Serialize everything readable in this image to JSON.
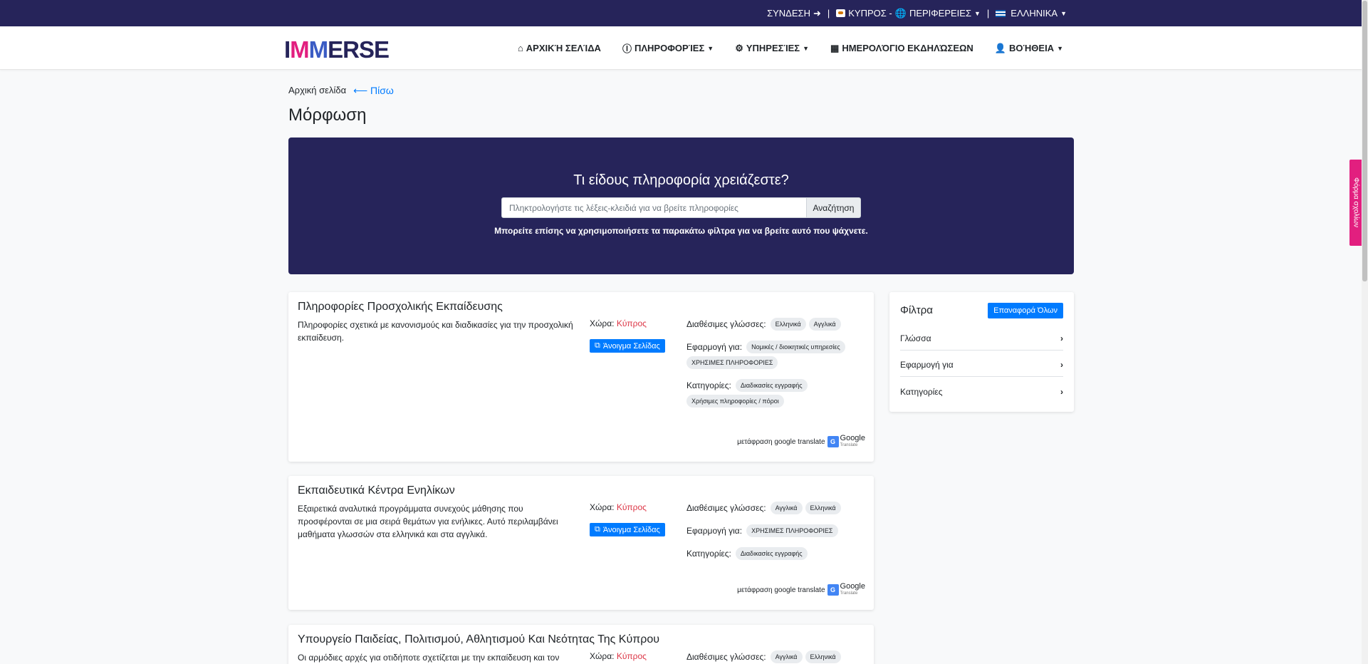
{
  "topbar": {
    "login": "ΣΥΝΔΕΣΗ",
    "country": "ΚΥΠΡΟΣ -",
    "regions": "ΠΕΡΙΦΕΡΕΙΕΣ",
    "language": "ΕΛΛΗΝΙΚΑ",
    "separator": "|"
  },
  "nav": {
    "logo": {
      "part1": "I",
      "part2": "M",
      "part3": "M",
      "part4": "ERSE"
    },
    "home": "ΑΡΧΙΚΉ ΣΕΛΊΔΑ",
    "info": "ΠΛΗΡΟΦΟΡΊΕΣ",
    "services": "ΥΠΗΡΕΣΊΕΣ",
    "calendar": "ΗΜΕΡΟΛΌΓΙΟ ΕΚΔΗΛΏΣΕΩΝ",
    "help": "ΒΟΉΘΕΙΑ"
  },
  "breadcrumb": {
    "home": "Αρχική σελίδα",
    "back": "⟵ Πίσω"
  },
  "page_title": "Μόρφωση",
  "hero": {
    "heading": "Τι είδους πληροφορία χρειάζεστε?",
    "search_placeholder": "Πληκτρολογήστε τις λέξεις-κλειδιά για να βρείτε πληροφορίες",
    "search_button": "Αναζήτηση",
    "hint": "Μπορείτε επίσης να χρησιμοποιήσετε τα παρακάτω φίλτρα για να βρείτε αυτό που ψάχνετε."
  },
  "labels": {
    "country": "Χώρα:",
    "open_page": "Άνοιγμα Σελίδας",
    "languages": "Διαθέσιμες γλώσσες:",
    "applies_to": "Εφαρμογή για:",
    "categories": "Κατηγορίες:",
    "translation": "μετάφραση google translate",
    "google": "Google",
    "translate": "Translate"
  },
  "cards": [
    {
      "title": "Πληροφορίες Προσχολικής Εκπαίδευσης",
      "description": "Πληροφορίες σχετικά με κανονισμούς και διαδικασίες για την προσχολική εκπαίδευση.",
      "country": "Κύπρος",
      "languages": [
        "Ελληνικά",
        "Αγγλικά"
      ],
      "applies_to": [
        "Νομικές / διοικητικές υπηρεσίες",
        "ΧΡΗΣΙΜΕΣ ΠΛΗΡΟΦΟΡΙΕΣ"
      ],
      "categories": [
        "Διαδικασίες εγγραφής",
        "Χρήσιμες πληροφορίες / πόροι"
      ]
    },
    {
      "title": "Εκπαιδευτικά Κέντρα Ενηλίκων",
      "description": "Εξαιρετικά αναλυτικά προγράμματα συνεχούς μάθησης που προσφέρονται σε μια σειρά θεμάτων για ενήλικες. Αυτό περιλαμβάνει μαθήματα γλωσσών στα ελληνικά και στα αγγλικά.",
      "country": "Κύπρος",
      "languages": [
        "Αγγλικά",
        "Ελληνικά"
      ],
      "applies_to": [
        "ΧΡΗΣΙΜΕΣ ΠΛΗΡΟΦΟΡΙΕΣ"
      ],
      "categories": [
        "Διαδικασίες εγγραφής"
      ]
    },
    {
      "title": "Υπουργείο Παιδείας, Πολιτισμού, Αθλητισμού Και Νεότητας Της Κύπρου",
      "description": "Οι αρμόδιες αρχές για οτιδήποτε σχετίζεται με την εκπαίδευση και τον",
      "country": "Κύπρος",
      "languages": [
        "Αγγλικά",
        "Ελληνικά"
      ]
    }
  ],
  "filters": {
    "title": "Φίλτρα",
    "reset": "Επαναφορά Όλων",
    "items": [
      "Γλώσσα",
      "Εφαρμογή για",
      "Κατηγορίες"
    ]
  },
  "side_tab": "Φόρμα σχολίων",
  "colors": {
    "brand_dark": "#26245a",
    "accent_blue": "#007bff",
    "accent_pink": "#e21f7f",
    "country_red": "#dc3545"
  }
}
